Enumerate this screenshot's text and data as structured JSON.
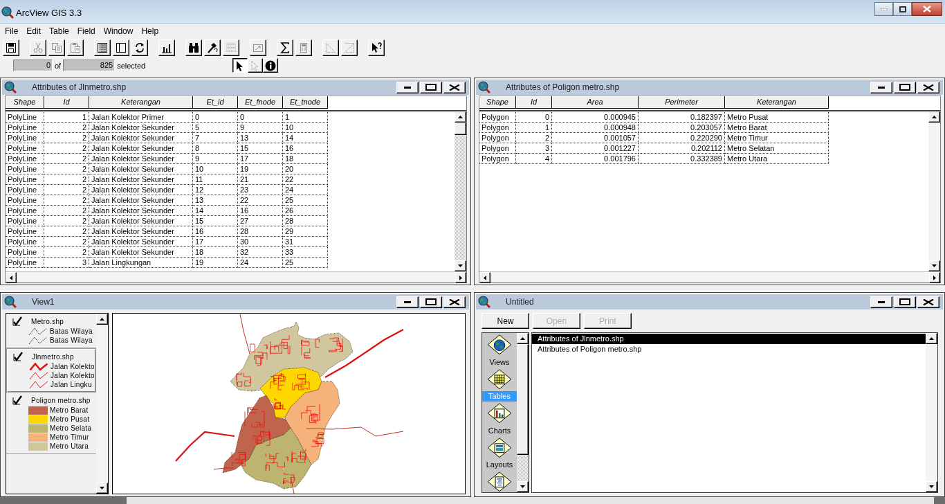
{
  "app": {
    "title": "ArcView GIS 3.3"
  },
  "menu": [
    {
      "label": "File"
    },
    {
      "label": "Edit"
    },
    {
      "label": "Table"
    },
    {
      "label": "Field"
    },
    {
      "label": "Window"
    },
    {
      "label": "Help"
    }
  ],
  "toolbar": {
    "groups": [
      {
        "buttons": [
          {
            "disabled": false
          }
        ]
      },
      {
        "buttons": [
          {
            "disabled": true
          },
          {
            "disabled": true
          },
          {
            "disabled": true
          }
        ]
      },
      {
        "buttons": [
          {
            "disabled": false
          },
          {
            "disabled": false
          },
          {
            "disabled": false
          }
        ]
      },
      {
        "buttons": [
          {
            "disabled": false
          }
        ]
      },
      {
        "buttons": [
          {
            "disabled": false
          },
          {
            "disabled": false
          },
          {
            "disabled": true
          }
        ]
      },
      {
        "buttons": [
          {
            "disabled": true
          }
        ]
      },
      {
        "buttons": [
          {
            "disabled": false
          },
          {
            "disabled": true
          }
        ]
      },
      {
        "buttons": [
          {
            "disabled": true
          },
          {
            "disabled": true
          }
        ]
      },
      {
        "buttons": [
          {
            "disabled": false
          }
        ]
      }
    ]
  },
  "status": {
    "selected_count": "0",
    "of_label": "of",
    "total_count": "825",
    "suffix": "selected"
  },
  "tools": [
    {
      "selected": true,
      "disabled": false
    },
    {
      "selected": false,
      "disabled": true
    },
    {
      "selected": false,
      "disabled": false
    }
  ],
  "attribute_tables": [
    {
      "title": "Attributes of Jlnmetro.shp",
      "columns": [
        {
          "label": "Shape",
          "kind": "text"
        },
        {
          "label": "Id",
          "kind": "number"
        },
        {
          "label": "Keterangan",
          "kind": "text"
        },
        {
          "label": "Et_id",
          "kind": "text"
        },
        {
          "label": "Et_fnode",
          "kind": "text"
        },
        {
          "label": "Et_tnode",
          "kind": "text"
        }
      ],
      "rows": [
        [
          "PolyLine",
          "1",
          "Jalan Kolektor Primer",
          "0",
          "0",
          "1"
        ],
        [
          "PolyLine",
          "2",
          "Jalan Kolektor Sekunder",
          "5",
          "9",
          "10"
        ],
        [
          "PolyLine",
          "2",
          "Jalan Kolektor Sekunder",
          "7",
          "13",
          "14"
        ],
        [
          "PolyLine",
          "2",
          "Jalan Kolektor Sekunder",
          "8",
          "15",
          "16"
        ],
        [
          "PolyLine",
          "2",
          "Jalan Kolektor Sekunder",
          "9",
          "17",
          "18"
        ],
        [
          "PolyLine",
          "2",
          "Jalan Kolektor Sekunder",
          "10",
          "19",
          "20"
        ],
        [
          "PolyLine",
          "2",
          "Jalan Kolektor Sekunder",
          "11",
          "21",
          "22"
        ],
        [
          "PolyLine",
          "2",
          "Jalan Kolektor Sekunder",
          "12",
          "23",
          "24"
        ],
        [
          "PolyLine",
          "2",
          "Jalan Kolektor Sekunder",
          "13",
          "22",
          "25"
        ],
        [
          "PolyLine",
          "2",
          "Jalan Kolektor Sekunder",
          "14",
          "16",
          "26"
        ],
        [
          "PolyLine",
          "2",
          "Jalan Kolektor Sekunder",
          "15",
          "27",
          "28"
        ],
        [
          "PolyLine",
          "2",
          "Jalan Kolektor Sekunder",
          "16",
          "28",
          "29"
        ],
        [
          "PolyLine",
          "2",
          "Jalan Kolektor Sekunder",
          "17",
          "30",
          "31"
        ],
        [
          "PolyLine",
          "2",
          "Jalan Kolektor Sekunder",
          "18",
          "32",
          "33"
        ],
        [
          "PolyLine",
          "3",
          "Jalan Lingkungan",
          "19",
          "24",
          "25"
        ]
      ]
    },
    {
      "title": "Attributes of Poligon metro.shp",
      "columns": [
        {
          "label": "Shape",
          "kind": "text"
        },
        {
          "label": "Id",
          "kind": "number"
        },
        {
          "label": "Area",
          "kind": "number"
        },
        {
          "label": "Perimeter",
          "kind": "number"
        },
        {
          "label": "Keterangan",
          "kind": "text"
        }
      ],
      "rows": [
        [
          "Polygon",
          "0",
          "0.000945",
          "0.182397",
          "Metro Pusat"
        ],
        [
          "Polygon",
          "1",
          "0.000948",
          "0.203057",
          "Metro Barat"
        ],
        [
          "Polygon",
          "2",
          "0.001057",
          "0.220290",
          "Metro Timur"
        ],
        [
          "Polygon",
          "3",
          "0.001227",
          "0.202112",
          "Metro Selatan"
        ],
        [
          "Polygon",
          "4",
          "0.001796",
          "0.332389",
          "Metro Utara"
        ]
      ]
    }
  ],
  "view": {
    "title": "View1",
    "layers": [
      {
        "name": "Metro.shp",
        "visible": true,
        "active": false,
        "items": [
          {
            "kind": "dotted-line",
            "label": "Batas Wilaya"
          },
          {
            "kind": "dotted-line",
            "label": "Batas Wilaya"
          }
        ]
      },
      {
        "name": "Jlnmetro.shp",
        "visible": true,
        "active": true,
        "items": [
          {
            "kind": "thick-line",
            "label": "Jalan Kolekto"
          },
          {
            "kind": "thin-line",
            "label": "Jalan Kolekto"
          },
          {
            "kind": "thin-line",
            "label": "Jalan Lingku"
          }
        ]
      },
      {
        "name": "Poligon metro.shp",
        "visible": true,
        "active": false,
        "items": [
          {
            "kind": "swatch",
            "label": "Metro Barat",
            "color": "#c0654c"
          },
          {
            "kind": "swatch",
            "label": "Metro Pusat",
            "color": "#ffd700"
          },
          {
            "kind": "swatch",
            "label": "Metro Selata",
            "color": "#bdb56f"
          },
          {
            "kind": "swatch",
            "label": "Metro Timur",
            "color": "#f5b27a"
          },
          {
            "kind": "swatch",
            "label": "Metro Utara",
            "color": "#d1c79f"
          }
        ]
      }
    ]
  },
  "project": {
    "title": "Untitled",
    "buttons": [
      {
        "label": "New",
        "disabled": false
      },
      {
        "label": "Open",
        "disabled": true
      },
      {
        "label": "Print",
        "disabled": true
      }
    ],
    "doc_types": [
      {
        "label": "Views",
        "selected": false
      },
      {
        "label": "Tables",
        "selected": true
      },
      {
        "label": "Charts",
        "selected": false
      },
      {
        "label": "Layouts",
        "selected": false
      }
    ],
    "documents": [
      {
        "label": "Attributes of Jlnmetro.shp",
        "selected": true
      },
      {
        "label": "Attributes of Poligon metro.shp",
        "selected": false
      }
    ]
  }
}
